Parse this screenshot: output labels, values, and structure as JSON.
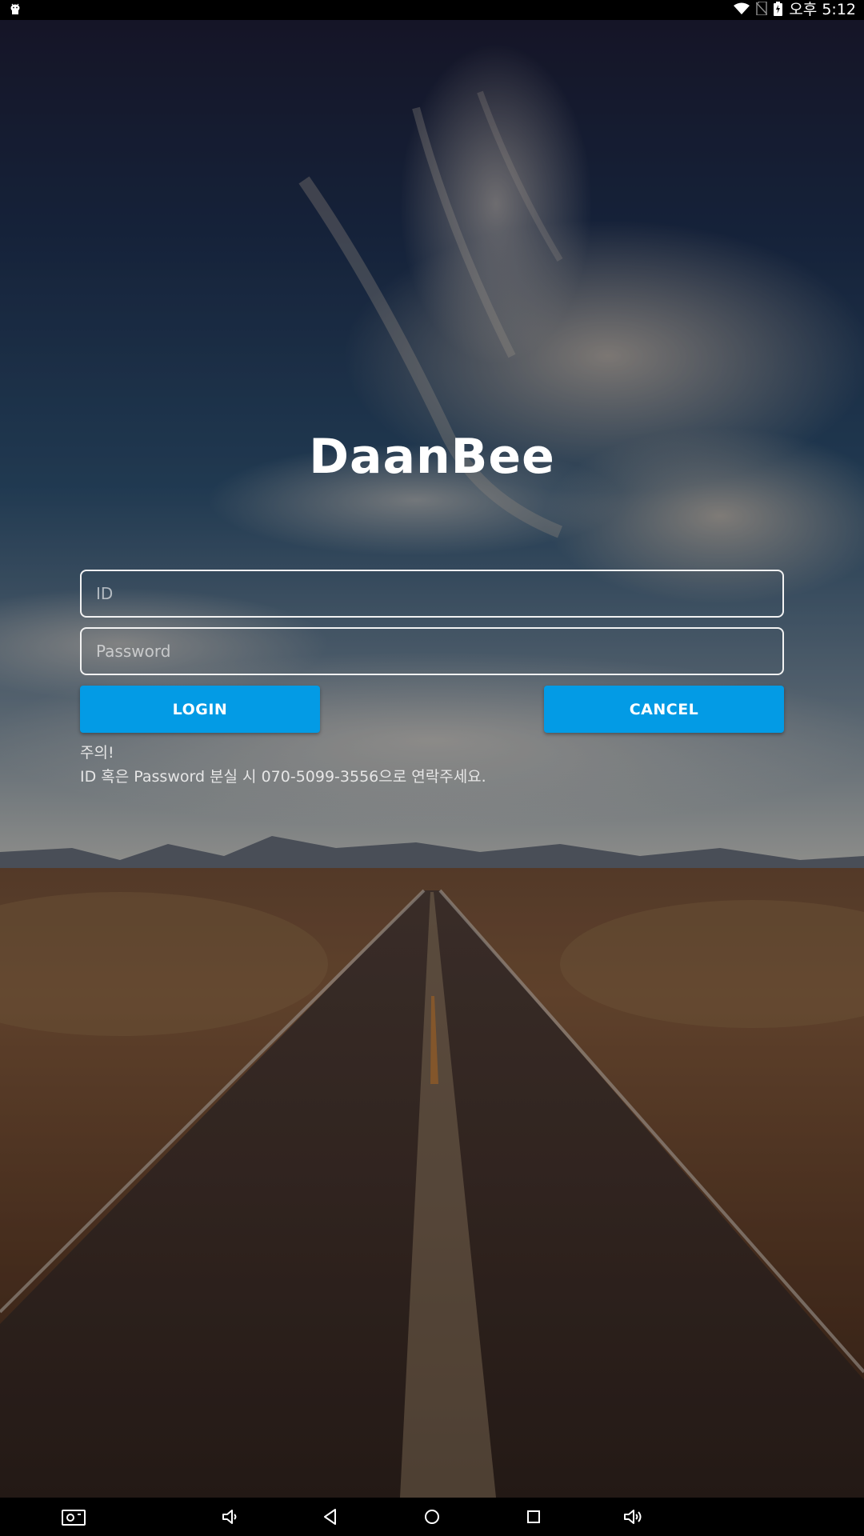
{
  "status_bar": {
    "left_icon": "android-debug-icon",
    "icons": [
      "wifi-icon",
      "no-sim-icon",
      "battery-charging-icon"
    ],
    "time": "오후 5:12"
  },
  "background": {
    "description_icon": "desert-road-sky-photo"
  },
  "login": {
    "title": "DaanBee",
    "id_placeholder": "ID",
    "id_value": "",
    "password_placeholder": "Password",
    "password_value": "",
    "login_label": "LOGIN",
    "cancel_label": "CANCEL",
    "notice_title": "주의!",
    "notice_text": "ID 혹은 Password 분실 시 070-5099-3556으로 연락주세요."
  },
  "colors": {
    "button": "#039be5",
    "button_text": "#ffffff",
    "input_border": "#f2f2f2",
    "title": "#ffffff"
  },
  "nav_bar": {
    "icons": [
      "screenshot-icon",
      "volume-down-icon",
      "back-icon",
      "home-icon",
      "recents-icon",
      "volume-up-icon"
    ]
  }
}
